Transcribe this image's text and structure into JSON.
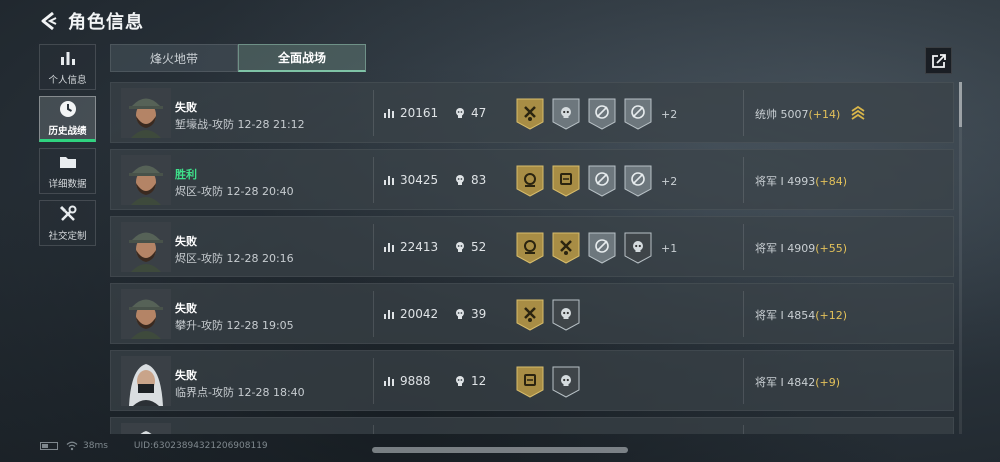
{
  "header": {
    "title": "角色信息"
  },
  "sidebar": {
    "items": [
      {
        "label": "个人信息",
        "icon": "bar-chart-icon",
        "active": false
      },
      {
        "label": "历史战绩",
        "icon": "clock-icon",
        "active": true
      },
      {
        "label": "详细数据",
        "icon": "folder-icon",
        "active": false
      },
      {
        "label": "社交定制",
        "icon": "tools-icon",
        "active": false
      }
    ]
  },
  "tabs": [
    {
      "label": "烽火地带",
      "active": false
    },
    {
      "label": "全面战场",
      "active": true
    }
  ],
  "matches": [
    {
      "result": "失败",
      "win": false,
      "map": "堑壕战-攻防",
      "time": "12-28 21:12",
      "score": "20161",
      "kills": "47",
      "medals": [
        "gold-axes",
        "silver-skull",
        "silver-cross",
        "silver-cross"
      ],
      "more": "+2",
      "rank_label": "统帅",
      "rank_value": "5007",
      "rank_gain": "(+14)",
      "rank_icon": "chevron-rank-icon",
      "avatar": "soldier"
    },
    {
      "result": "胜利",
      "win": true,
      "map": "烬区-攻防",
      "time": "12-28 20:40",
      "score": "30425",
      "kills": "83",
      "medals": [
        "gold-crown",
        "gold-box",
        "silver-cross",
        "silver-cross"
      ],
      "more": "+2",
      "rank_label": "将军 Ⅰ",
      "rank_value": "4993",
      "rank_gain": "(+84)",
      "rank_icon": "",
      "avatar": "soldier"
    },
    {
      "result": "失败",
      "win": false,
      "map": "烬区-攻防",
      "time": "12-28 20:16",
      "score": "22413",
      "kills": "52",
      "medals": [
        "gold-crown",
        "gold-axes",
        "silver-cross",
        "dark-skull"
      ],
      "more": "+1",
      "rank_label": "将军 Ⅰ",
      "rank_value": "4909",
      "rank_gain": "(+55)",
      "rank_icon": "",
      "avatar": "soldier"
    },
    {
      "result": "失败",
      "win": false,
      "map": "攀升-攻防",
      "time": "12-28 19:05",
      "score": "20042",
      "kills": "39",
      "medals": [
        "gold-axes",
        "dark-skull"
      ],
      "more": "",
      "rank_label": "将军 Ⅰ",
      "rank_value": "4854",
      "rank_gain": "(+12)",
      "rank_icon": "",
      "avatar": "soldier"
    },
    {
      "result": "失败",
      "win": false,
      "map": "临界点-攻防",
      "time": "12-28 18:40",
      "score": "9888",
      "kills": "12",
      "medals": [
        "gold-box",
        "dark-skull"
      ],
      "more": "",
      "rank_label": "将军 Ⅰ",
      "rank_value": "4842",
      "rank_gain": "(+9)",
      "rank_icon": "",
      "avatar": "woman"
    },
    {
      "result": "",
      "win": false,
      "map": "",
      "time": "",
      "score": "",
      "kills": "",
      "medals": [],
      "more": "",
      "rank_label": "",
      "rank_value": "",
      "rank_gain": "",
      "rank_icon": "",
      "avatar": "woman"
    }
  ],
  "footer": {
    "ping": "38ms",
    "uid": "UID:6302389432120690811​9"
  },
  "colors": {
    "win": "#3ee08a",
    "gain": "#e3c15a",
    "active_tab_accent": "#7fc3a6",
    "active_side_accent": "#2fd37f"
  }
}
